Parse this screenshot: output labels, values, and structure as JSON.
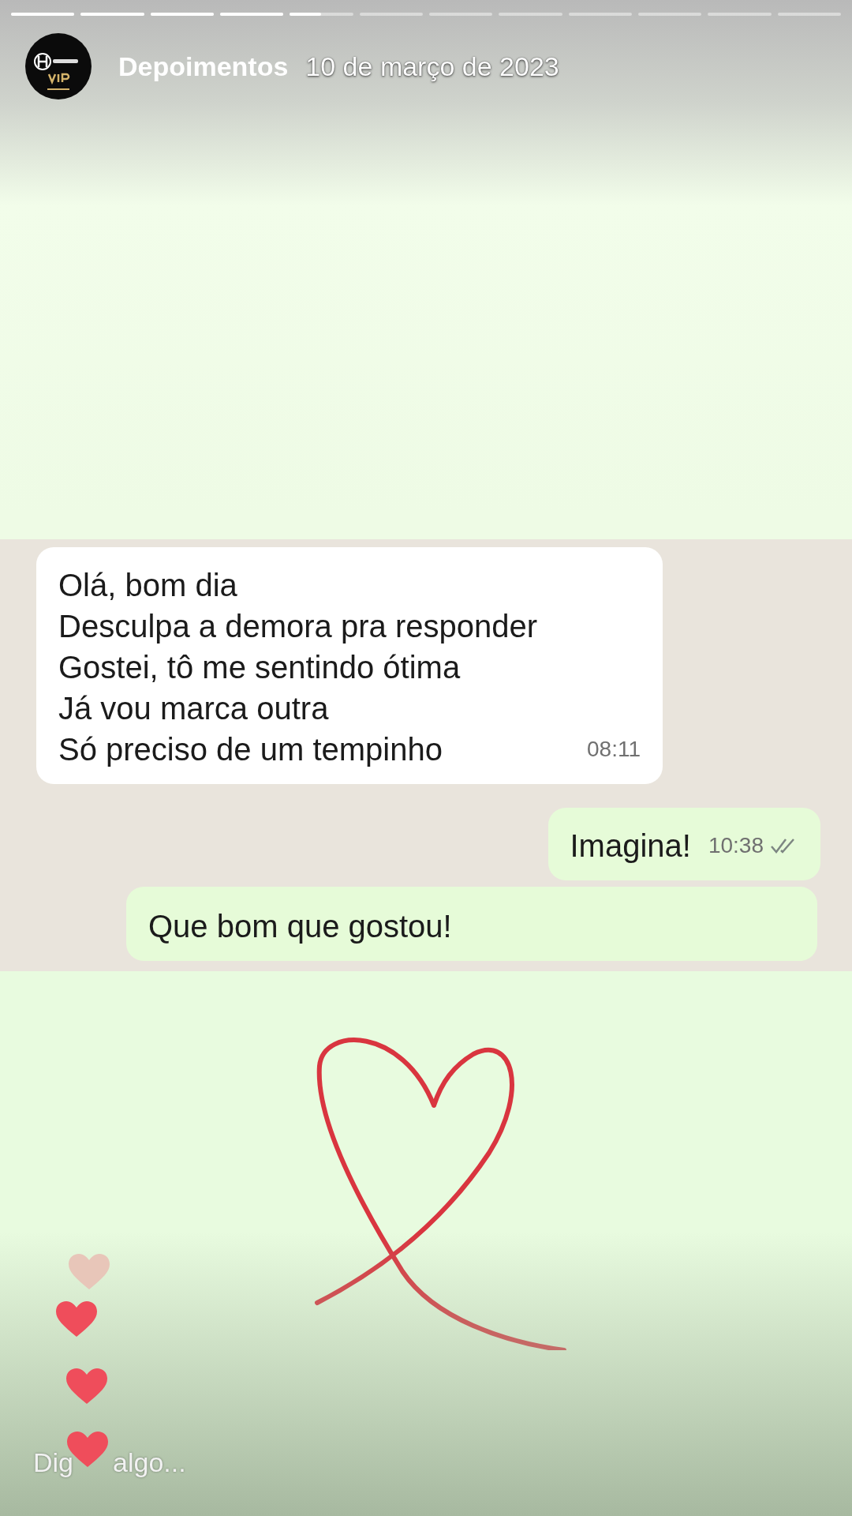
{
  "progress": [
    {
      "level": 1
    },
    {
      "level": 1
    },
    {
      "level": 1
    },
    {
      "level": 1
    },
    {
      "level": 0.5
    },
    {
      "level": 0
    },
    {
      "level": 0
    },
    {
      "level": 0
    },
    {
      "level": 0
    },
    {
      "level": 0
    },
    {
      "level": 0
    },
    {
      "level": 0
    }
  ],
  "header": {
    "account": "Depoimentos",
    "date": "10 de março de 2023"
  },
  "chat": {
    "messages": [
      {
        "kind": "received",
        "lines": [
          "Olá, bom dia",
          "Desculpa a demora pra responder",
          "Gostei, tô me sentindo ótima",
          "Já vou marca outra",
          "Só preciso de um tempinho"
        ],
        "time": "08:11"
      },
      {
        "kind": "sent",
        "lines": [
          "Imagina!"
        ],
        "time": "10:38",
        "read": false
      },
      {
        "kind": "sent_cut",
        "lines": [
          "Que bom que gostou!"
        ]
      }
    ]
  },
  "reactions": [
    {
      "color": "#e8c6b9"
    },
    {
      "color": "#ef4d5b"
    },
    {
      "color": "#ef4d5b"
    },
    {
      "color": "#ef4d5b"
    }
  ],
  "reply": {
    "visible_parts": [
      "Dig",
      "algo..."
    ]
  }
}
